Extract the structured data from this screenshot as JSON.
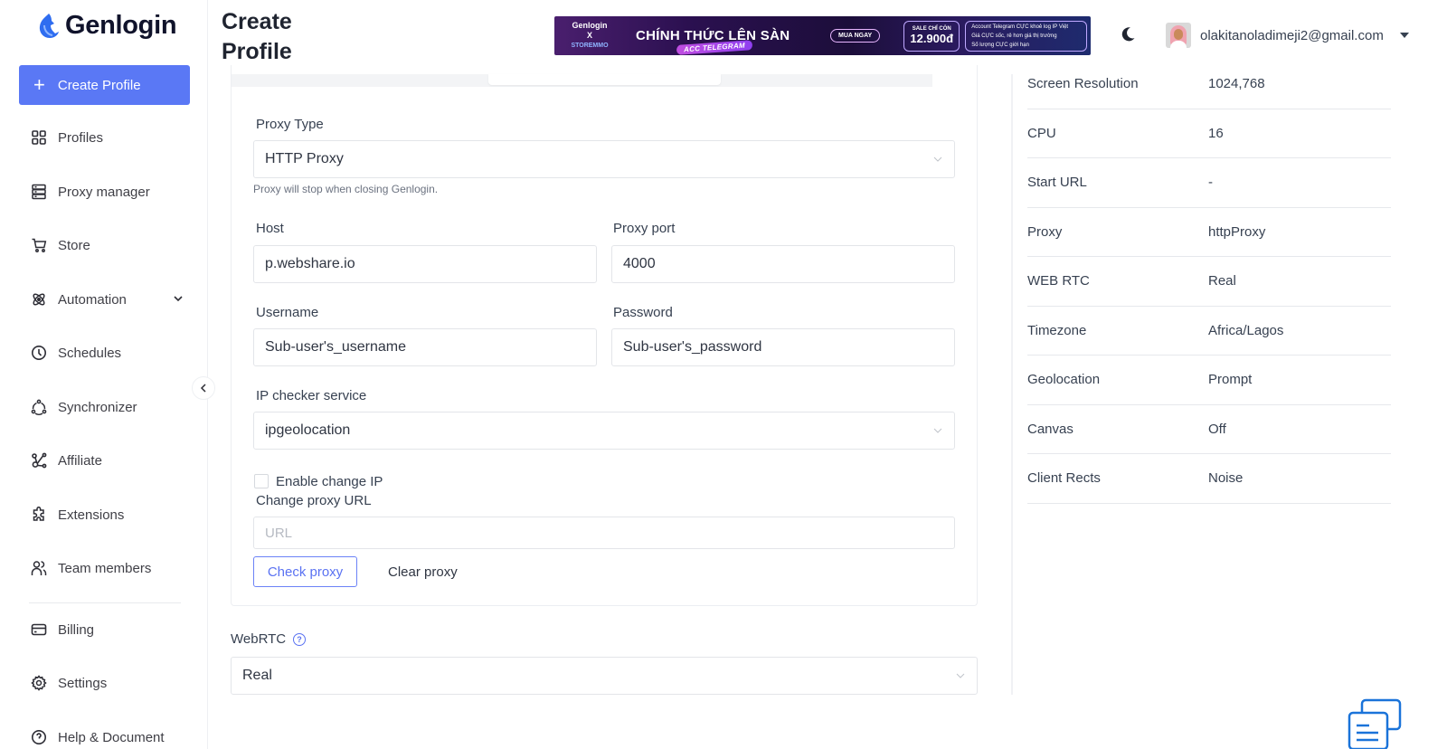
{
  "app": {
    "brand": "Genlogin",
    "page_title_line1": "Create",
    "page_title_line2": "Profile"
  },
  "sidebar": {
    "create_button": "Create Profile",
    "items": [
      {
        "label": "Profiles",
        "icon": "grid-icon"
      },
      {
        "label": "Proxy manager",
        "icon": "server-icon"
      },
      {
        "label": "Store",
        "icon": "cart-icon"
      },
      {
        "label": "Automation",
        "icon": "atom-icon",
        "has_submenu": true
      },
      {
        "label": "Schedules",
        "icon": "clock-icon"
      },
      {
        "label": "Synchronizer",
        "icon": "sync-icon"
      },
      {
        "label": "Affiliate",
        "icon": "affiliate-icon"
      },
      {
        "label": "Extensions",
        "icon": "puzzle-icon"
      },
      {
        "label": "Team members",
        "icon": "users-icon"
      },
      {
        "label": "Billing",
        "icon": "card-icon"
      },
      {
        "label": "Settings",
        "icon": "gear-icon"
      },
      {
        "label": "Help & Document",
        "icon": "help-icon"
      }
    ]
  },
  "header": {
    "banner": {
      "brand_top": "Genlogin",
      "brand_x": "X",
      "brand_bottom": "STOREMMO",
      "headline": "CHÍNH THỨC LÊN SÀN",
      "tag": "ACC TELEGRAM",
      "buy": "MUA NGAY",
      "sale_label": "SALE CHỈ CÒN",
      "sale_price": "12.900đ",
      "features": [
        "Account Telegram CỰC khoẻ log IP Việt",
        "Giá CỰC sốc, rẻ hơn giá thị trường",
        "Số lượng CỰC giới hạn"
      ]
    },
    "user_email": "olakitanoladimeji2@gmail.com"
  },
  "form": {
    "proxy_type": {
      "label": "Proxy Type",
      "value": "HTTP Proxy",
      "hint": "Proxy will stop when closing Genlogin."
    },
    "host": {
      "label": "Host",
      "value": "p.webshare.io"
    },
    "port": {
      "label": "Proxy port",
      "value": "4000"
    },
    "username": {
      "label": "Username",
      "value": "Sub-user's_username"
    },
    "password": {
      "label": "Password",
      "value": "Sub-user's_password"
    },
    "ip_checker": {
      "label": "IP checker service",
      "value": "ipgeolocation"
    },
    "enable_change_ip": {
      "label": "Enable change IP",
      "checked": false
    },
    "change_proxy_url": {
      "label": "Change proxy URL",
      "placeholder": "URL",
      "value": ""
    },
    "check_proxy": "Check proxy",
    "clear_proxy": "Clear proxy",
    "webrtc": {
      "label": "WebRTC",
      "value": "Real"
    }
  },
  "summary": [
    {
      "key": "Screen Resolution",
      "value": "1024,768"
    },
    {
      "key": "CPU",
      "value": "16"
    },
    {
      "key": "Start URL",
      "value": "-"
    },
    {
      "key": "Proxy",
      "value": "httpProxy"
    },
    {
      "key": "WEB RTC",
      "value": "Real"
    },
    {
      "key": "Timezone",
      "value": "Africa/Lagos"
    },
    {
      "key": "Geolocation",
      "value": "Prompt"
    },
    {
      "key": "Canvas",
      "value": "Off"
    },
    {
      "key": "Client Rects",
      "value": "Noise"
    }
  ],
  "colors": {
    "accent": "#5a78f5",
    "link": "#5a72f2"
  }
}
